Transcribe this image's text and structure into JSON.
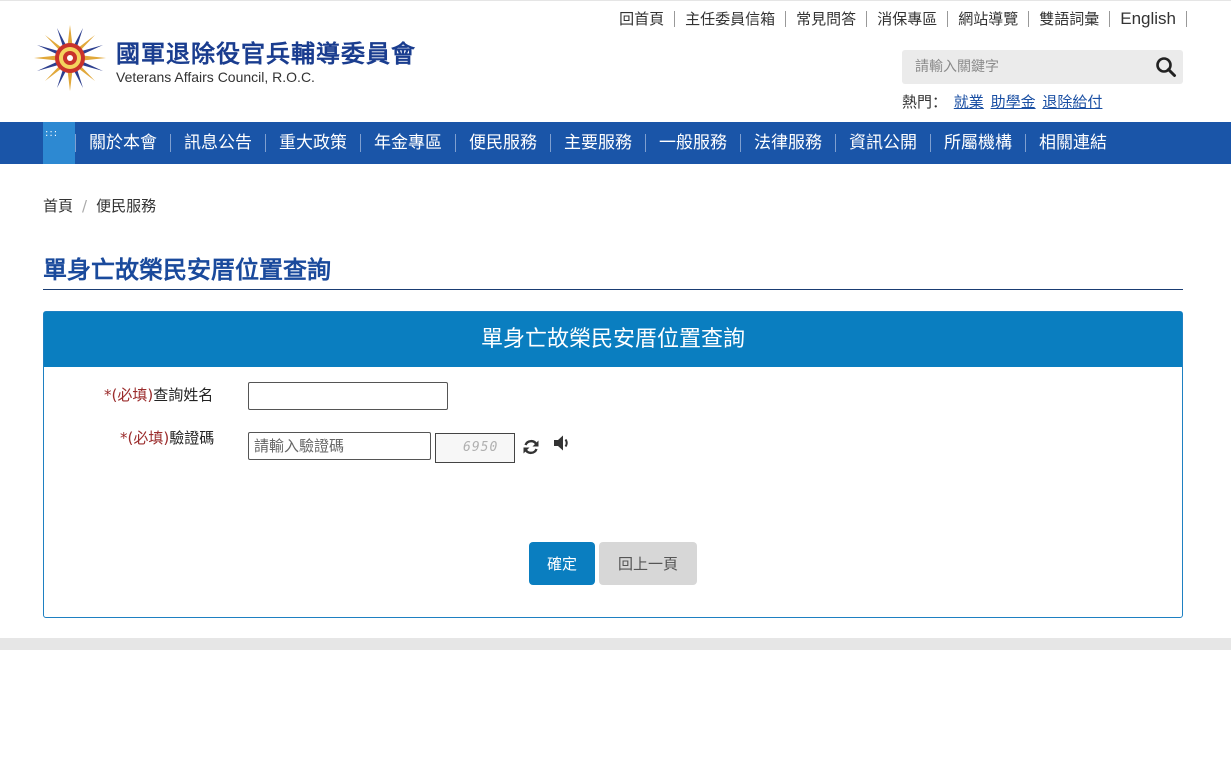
{
  "header": {
    "title": "國軍退除役官兵輔導委員會",
    "subtitle": "Veterans Affairs Council, R.O.C.",
    "top_links": [
      "回首頁",
      "主任委員信箱",
      "常見問答",
      "消保專區",
      "網站導覽",
      "雙語詞彙",
      "English"
    ],
    "search_placeholder": "請輸入關鍵字",
    "hot_label": "熱門：",
    "hot_links": [
      "就業",
      "助學金",
      "退除給付"
    ]
  },
  "nav": {
    "grip": ":::",
    "items": [
      "關於本會",
      "訊息公告",
      "重大政策",
      "年金專區",
      "便民服務",
      "主要服務",
      "一般服務",
      "法律服務",
      "資訊公開",
      "所屬機構",
      "相關連結"
    ]
  },
  "breadcrumb": {
    "home": "首頁",
    "separator": "/",
    "current": "便民服務"
  },
  "page": {
    "title": "單身亡故榮民安厝位置查詢"
  },
  "form": {
    "panel_title": "單身亡故榮民安厝位置查詢",
    "required_mark": "*(必填)",
    "name_label": "查詢姓名",
    "name_value": "",
    "captcha_label": "驗證碼",
    "captcha_placeholder": "請輸入驗證碼",
    "captcha_text": "6950",
    "submit_label": "確定",
    "back_label": "回上一頁"
  },
  "colors": {
    "brand_blue": "#1a3d8f",
    "nav_blue": "#1a55a8",
    "panel_blue": "#0a7ec0",
    "required_red": "#9b2c2c"
  },
  "icons": {
    "search": "search-icon",
    "refresh": "refresh-icon",
    "audio": "speaker-icon"
  }
}
